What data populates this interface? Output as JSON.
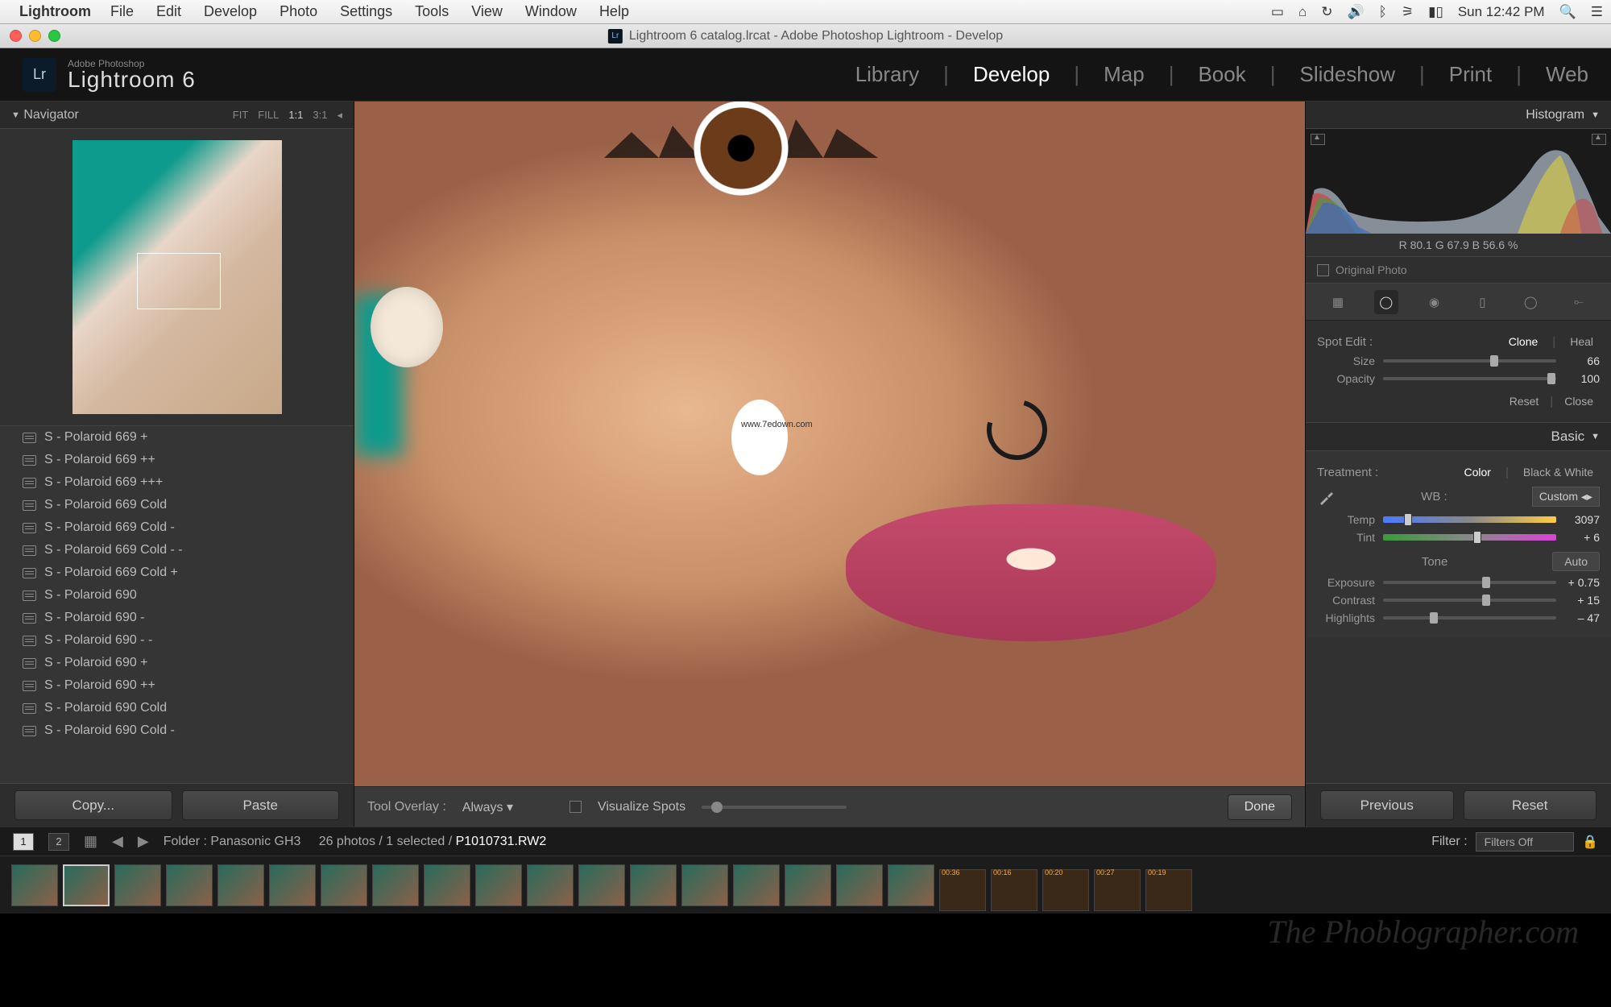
{
  "mac_menu": {
    "app": "Lightroom",
    "items": [
      "File",
      "Edit",
      "Develop",
      "Photo",
      "Settings",
      "Tools",
      "View",
      "Window",
      "Help"
    ],
    "clock": "Sun 12:42 PM"
  },
  "window_title": "Lightroom 6 catalog.lrcat - Adobe Photoshop Lightroom - Develop",
  "branding": {
    "sub": "Adobe Photoshop",
    "name": "Lightroom 6",
    "box": "Lr"
  },
  "modules": [
    "Library",
    "Develop",
    "Map",
    "Book",
    "Slideshow",
    "Print",
    "Web"
  ],
  "active_module": "Develop",
  "navigator": {
    "title": "Navigator",
    "zoom_opts": [
      "FIT",
      "FILL",
      "1:1",
      "3:1"
    ]
  },
  "presets": [
    "S - Polaroid 669 +",
    "S - Polaroid 669 ++",
    "S - Polaroid 669 +++",
    "S - Polaroid 669 Cold",
    "S - Polaroid 669 Cold -",
    "S - Polaroid 669 Cold - -",
    "S - Polaroid 669 Cold +",
    "S - Polaroid 690",
    "S - Polaroid 690 -",
    "S - Polaroid 690 - -",
    "S - Polaroid 690 +",
    "S - Polaroid 690 ++",
    "S - Polaroid 690 Cold",
    "S - Polaroid 690 Cold -"
  ],
  "left_buttons": {
    "copy": "Copy...",
    "paste": "Paste"
  },
  "center_toolbar": {
    "overlay_label": "Tool Overlay :",
    "overlay_value": "Always",
    "visualize": "Visualize Spots",
    "done": "Done"
  },
  "watermark_center": "www.7edown.com",
  "histogram": {
    "title": "Histogram",
    "rgb": "R  80.1   G  67.9   B  56.6  %",
    "original": "Original Photo"
  },
  "spot_edit": {
    "label": "Spot Edit :",
    "clone": "Clone",
    "heal": "Heal",
    "size_label": "Size",
    "size_val": "66",
    "opacity_label": "Opacity",
    "opacity_val": "100",
    "reset": "Reset",
    "close": "Close"
  },
  "basic": {
    "title": "Basic",
    "treatment_label": "Treatment :",
    "color": "Color",
    "bw": "Black & White",
    "wb_label": "WB :",
    "wb_value": "Custom",
    "temp_label": "Temp",
    "temp_val": "3097",
    "tint_label": "Tint",
    "tint_val": "+ 6",
    "tone_label": "Tone",
    "auto": "Auto",
    "exposure_label": "Exposure",
    "exposure_val": "+ 0.75",
    "contrast_label": "Contrast",
    "contrast_val": "+ 15",
    "highlights_label": "Highlights",
    "highlights_val": "– 47"
  },
  "right_buttons": {
    "prev": "Previous",
    "reset": "Reset"
  },
  "secondary": {
    "folder": "Folder : Panasonic GH3",
    "count": "26 photos / 1 selected /",
    "filename": "P1010731.RW2",
    "filter_label": "Filter :",
    "filter_value": "Filters Off"
  },
  "filmstrip_clips": [
    "00:36",
    "00:16",
    "00:20",
    "00:27",
    "00:19"
  ]
}
